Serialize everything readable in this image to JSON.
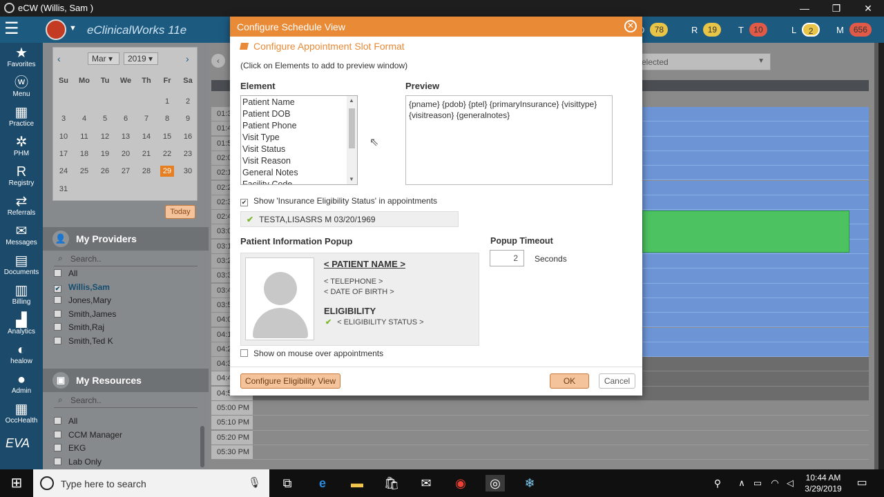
{
  "window": {
    "title": "eCW (Willis, Sam )",
    "minimize": "—",
    "restore": "❐",
    "close": "✕"
  },
  "header": {
    "brand": "eClinicalWorks 11e",
    "counters": [
      {
        "letter": "D",
        "value": "78",
        "color": "#e8c547"
      },
      {
        "letter": "R",
        "value": "19",
        "color": "#e8c547"
      },
      {
        "letter": "T",
        "value": "10",
        "color": "#e05a47"
      },
      {
        "letter": "L",
        "value": "2",
        "color": "#e8c547"
      },
      {
        "letter": "M",
        "value": "656",
        "color": "#e05a47"
      }
    ]
  },
  "nav": [
    {
      "label": "Favorites",
      "icon": "★"
    },
    {
      "label": "Menu",
      "icon": "ⓦ"
    },
    {
      "label": "Practice",
      "icon": "▦"
    },
    {
      "label": "PHM",
      "icon": "✲"
    },
    {
      "label": "Registry",
      "icon": "R"
    },
    {
      "label": "Referrals",
      "icon": "⇄"
    },
    {
      "label": "Messages",
      "icon": "✉"
    },
    {
      "label": "Documents",
      "icon": "▤"
    },
    {
      "label": "Billing",
      "icon": "▥"
    },
    {
      "label": "Analytics",
      "icon": "▟"
    },
    {
      "label": "healow",
      "icon": "◐"
    },
    {
      "label": "Admin",
      "icon": "●"
    },
    {
      "label": "OccHealth",
      "icon": "▦"
    }
  ],
  "nav_footer": "EVA",
  "calendar": {
    "month": "Mar",
    "year": "2019",
    "dow": [
      "Su",
      "Mo",
      "Tu",
      "We",
      "Th",
      "Fr",
      "Sa"
    ],
    "first_weekday": 5,
    "days_in_month": 31,
    "selected": 29,
    "today_label": "Today"
  },
  "providers": {
    "title": "My Providers",
    "search_placeholder": "Search..",
    "items": [
      {
        "label": "All",
        "checked": false
      },
      {
        "label": "Willis,Sam",
        "checked": true
      },
      {
        "label": "Jones,Mary",
        "checked": false
      },
      {
        "label": "Smith,James",
        "checked": false
      },
      {
        "label": "Smith,Raj",
        "checked": false
      },
      {
        "label": "Smith,Ted K",
        "checked": false
      }
    ]
  },
  "resources": {
    "title": "My Resources",
    "search_placeholder": "Search..",
    "items": [
      {
        "label": "All"
      },
      {
        "label": "CCM Manager"
      },
      {
        "label": "EKG"
      },
      {
        "label": "Lab Only"
      }
    ]
  },
  "schedule": {
    "provider_select": "elected",
    "rows": [
      {
        "time": "01:3",
        "kind": "blue"
      },
      {
        "time": "01:4",
        "kind": "blue"
      },
      {
        "time": "01:5",
        "kind": "blue"
      },
      {
        "time": "02:0",
        "kind": "blue"
      },
      {
        "time": "02:1",
        "kind": "blue"
      },
      {
        "time": "02:2",
        "kind": "blue"
      },
      {
        "time": "02:3",
        "kind": "blue"
      },
      {
        "time": "02:4",
        "kind": "green"
      },
      {
        "time": "03:0",
        "kind": "green"
      },
      {
        "time": "03:1",
        "kind": "blue"
      },
      {
        "time": "03:2",
        "kind": "blue"
      },
      {
        "time": "03:3",
        "kind": "blue"
      },
      {
        "time": "03:4",
        "kind": "blue"
      },
      {
        "time": "03:5",
        "kind": "blue"
      },
      {
        "time": "04:0",
        "kind": "blue"
      },
      {
        "time": "04:1",
        "kind": "blue"
      },
      {
        "time": "04:2",
        "kind": "blue"
      },
      {
        "time": "04:3",
        "kind": "gray"
      },
      {
        "time": "04:40 PM",
        "kind": "gray"
      },
      {
        "time": "04:50 PM",
        "kind": "gray"
      },
      {
        "time": "05:00 PM",
        "kind": "empty"
      },
      {
        "time": "05:10 PM",
        "kind": "empty"
      },
      {
        "time": "05:20 PM",
        "kind": "empty"
      },
      {
        "time": "05:30 PM",
        "kind": "empty"
      }
    ]
  },
  "dialog": {
    "title": "Configure Schedule View",
    "subtitle": "Configure Appointment Slot Format",
    "hint": "(Click on Elements to add to preview window)",
    "element_label": "Element",
    "elements": [
      "Patient Name",
      "Patient DOB",
      "Patient Phone",
      "Visit Type",
      "Visit Status",
      "Visit Reason",
      "General Notes",
      "Facility Code"
    ],
    "preview_label": "Preview",
    "preview_text": "{pname} {pdob} {ptel} {primaryInsurance} {visittype} {visitreason} {generalnotes}",
    "show_eligibility_label": "Show 'Insurance Eligibility Status' in appointments",
    "eligibility_sample": "TESTA,LISASRS M 03/20/1969",
    "popup_label": "Patient Information Popup",
    "popup_name": "< PATIENT NAME >",
    "popup_phone": "< TELEPHONE >",
    "popup_dob": "< DATE OF BIRTH >",
    "popup_eligibility_title": "ELIGIBILITY",
    "popup_eligibility_status": "< ELIGIBILITY STATUS >",
    "timeout_label": "Popup Timeout",
    "timeout_value": "2",
    "timeout_unit": "Seconds",
    "mouseover_label": "Show on mouse over appointments",
    "btn_configure": "Configure Eligibility View",
    "btn_ok": "OK",
    "btn_cancel": "Cancel"
  },
  "taskbar": {
    "search_placeholder": "Type here to search",
    "time": "10:44 AM",
    "date": "3/29/2019"
  }
}
